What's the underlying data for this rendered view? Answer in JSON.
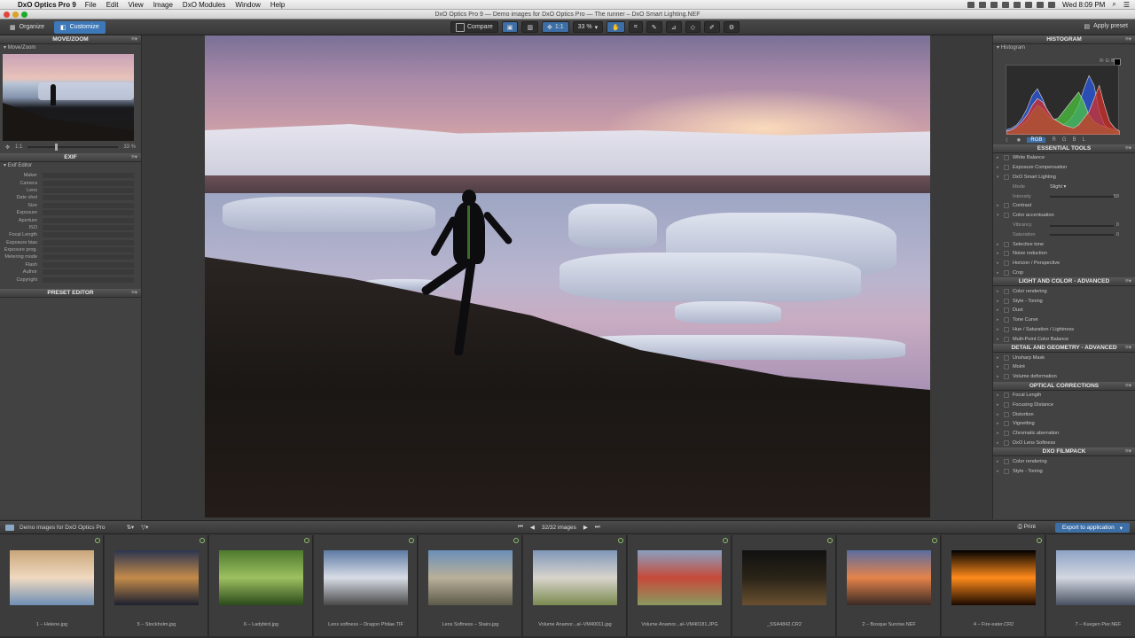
{
  "menubar": {
    "app_name": "DxO Optics Pro 9",
    "menus": [
      "File",
      "Edit",
      "View",
      "Image",
      "DxO Modules",
      "Window",
      "Help"
    ],
    "clock": "Wed 8:09 PM"
  },
  "window": {
    "title": "DxO Optics Pro 9 — Demo images for DxO Optics Pro — The runner – DxO Smart Lighting.NEF"
  },
  "toolbar": {
    "organize_label": "Organize",
    "customize_label": "Customize",
    "compare_label": "Compare",
    "zoom_one_label": "1:1",
    "zoom_percent": "33 %",
    "apply_preset_label": "Apply preset"
  },
  "left_panel": {
    "move_zoom_header": "MOVE/ZOOM",
    "move_zoom_sub": "Move/Zoom",
    "zoom_one": "1:1",
    "zoom_value": "33 %",
    "exif_header": "EXIF",
    "exif_sub": "Exif Editor",
    "exif_fields": [
      "Maker",
      "Camera",
      "Lens",
      "Date shot",
      "Size",
      "Exposure",
      "Aperture",
      "ISO",
      "Focal Length",
      "Exposure bias",
      "Exposure prog.",
      "Metering mode",
      "Flash",
      "Author",
      "Copyright"
    ],
    "preset_editor_header": "PRESET EDITOR"
  },
  "right_panel": {
    "histogram_header": "HISTOGRAM",
    "histogram_sub": "Histogram",
    "rgb_label": "R: G: B:",
    "channels": [
      "RGB",
      "R",
      "G",
      "B",
      "L"
    ],
    "essential_header": "ESSENTIAL TOOLS",
    "essential_tools": [
      "White Balance",
      "Exposure Compensation",
      "DxO Smart Lighting"
    ],
    "smart_mode_label": "Mode",
    "smart_mode_value": "Slight",
    "smart_intensity_label": "Intensity",
    "smart_intensity_value": "50",
    "contrast_label": "Contrast",
    "color_accent_label": "Color accentuation",
    "vibrancy_label": "Vibrancy",
    "vibrancy_value": "0",
    "saturation_label": "Saturation",
    "saturation_value": "0",
    "essential_more": [
      "Selective tone",
      "Noise reduction",
      "Horizon / Perspective",
      "Crop"
    ],
    "light_color_header": "LIGHT AND COLOR - ADVANCED",
    "light_color_tools": [
      "Color rendering",
      "Style - Toning",
      "Dust",
      "Tone Curve",
      "Hue / Saturation / Lightness",
      "Multi-Point Color Balance"
    ],
    "detail_header": "DETAIL AND GEOMETRY - ADVANCED",
    "detail_tools": [
      "Unsharp Mask",
      "Moiré",
      "Volume deformation"
    ],
    "optical_header": "OPTICAL CORRECTIONS",
    "optical_tools": [
      "Focal Length",
      "Focusing Distance",
      "Distortion",
      "Vignetting",
      "Chromatic aberration",
      "DxO Lens Softness"
    ],
    "filmpack_header": "DXO FILMPACK",
    "filmpack_tools": [
      "Color rendering",
      "Style - Toning"
    ]
  },
  "filmbar": {
    "folder_label": "Demo images for DxO Optics Pro",
    "counter": "32/32 images",
    "print_label": "Print",
    "export_label": "Export to application"
  },
  "filmstrip": [
    {
      "caption": "1 – Helene.jpg",
      "colors": [
        "#c9a67a",
        "#f0d9c0",
        "#6f8fb5"
      ]
    },
    {
      "caption": "5 – Stockholm.jpg",
      "colors": [
        "#2c3550",
        "#c48b4a",
        "#1c2030"
      ]
    },
    {
      "caption": "6 – Ladybird.jpg",
      "colors": [
        "#4e7a2e",
        "#9dc060",
        "#2b4a1a"
      ]
    },
    {
      "caption": "Lens softness – Dragon Philae.TIF",
      "colors": [
        "#5d7aa3",
        "#d8dde6",
        "#4a4a4a"
      ]
    },
    {
      "caption": "Lens Softness – Stairs.jpg",
      "colors": [
        "#6a8fb8",
        "#b9b09a",
        "#5c5a4a"
      ]
    },
    {
      "caption": "Volume Anamor...al–VM40011.jpg",
      "colors": [
        "#7f97b8",
        "#d8d4cc",
        "#7a8a50"
      ]
    },
    {
      "caption": "Volume Anamor...al–VM40181.JPG",
      "colors": [
        "#8aa0c0",
        "#c64a3a",
        "#8a9a60"
      ]
    },
    {
      "caption": "_SSA4842.CR2",
      "colors": [
        "#111111",
        "#2a2418",
        "#6a5030"
      ]
    },
    {
      "caption": "2 – Bosque Sunrise.NEF",
      "colors": [
        "#5a6da0",
        "#e5834a",
        "#3a2a24"
      ]
    },
    {
      "caption": "4 – Fire-eater.CR2",
      "colors": [
        "#000000",
        "#ff8a1a",
        "#1a0a00"
      ]
    },
    {
      "caption": "7 – Kuegen Pier.NEF",
      "colors": [
        "#8fa3c6",
        "#d2d7e0",
        "#4a5262"
      ]
    }
  ],
  "histogram_data": {
    "red": [
      2,
      3,
      5,
      8,
      12,
      18,
      22,
      20,
      15,
      10,
      8,
      6,
      5,
      4,
      6,
      10,
      14,
      22,
      30,
      18,
      8,
      4,
      2
    ],
    "green": [
      2,
      3,
      4,
      6,
      9,
      14,
      18,
      16,
      12,
      9,
      10,
      14,
      18,
      22,
      26,
      20,
      12,
      8,
      6,
      5,
      4,
      3,
      2
    ],
    "blue": [
      3,
      4,
      6,
      10,
      16,
      24,
      28,
      22,
      14,
      10,
      8,
      6,
      8,
      12,
      18,
      28,
      36,
      30,
      14,
      6,
      3,
      2,
      1
    ],
    "colors": {
      "red": "#d2302a",
      "green": "#4cc640",
      "blue": "#2a5ae0",
      "luma": "#d8d8d8"
    }
  },
  "accent_color": "#3d6fa6"
}
